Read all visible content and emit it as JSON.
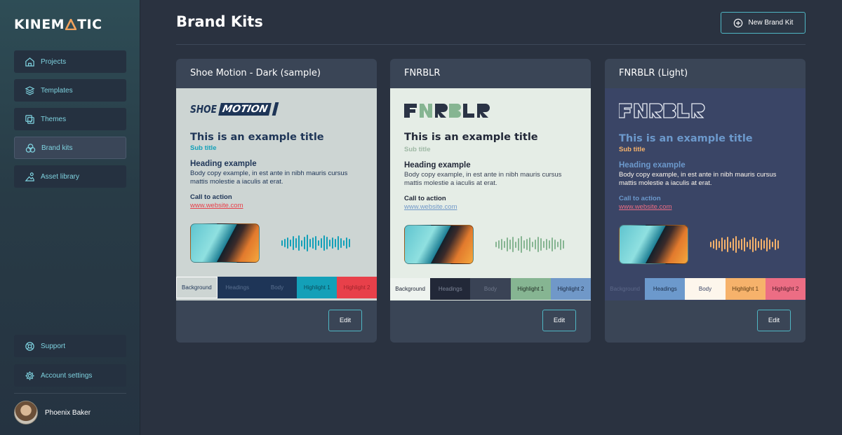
{
  "app": {
    "logo_text_a": "KINEM",
    "logo_text_b": "TIC",
    "accent": "#4fb6c4"
  },
  "sidebar": {
    "items": [
      {
        "label": "Projects",
        "icon": "home-icon"
      },
      {
        "label": "Templates",
        "icon": "layers-icon"
      },
      {
        "label": "Themes",
        "icon": "themes-icon"
      },
      {
        "label": "Brand kits",
        "icon": "palette-icon",
        "active": true
      },
      {
        "label": "Asset library",
        "icon": "image-icon"
      }
    ],
    "bottom_items": [
      {
        "label": "Support",
        "icon": "lifebuoy-icon"
      },
      {
        "label": "Account settings",
        "icon": "gear-icon"
      }
    ],
    "user": {
      "name": "Phoenix Baker"
    }
  },
  "header": {
    "title": "Brand Kits",
    "new_button_label": "New Brand Kit"
  },
  "cards": [
    {
      "title": "Shoe Motion - Dark (sample)",
      "logo_text_a": "SHOE",
      "logo_text_b": "MOTION",
      "preview_title": "This is an example title",
      "preview_subtitle": "Sub title",
      "preview_heading": "Heading example",
      "preview_body": "Body copy example, in est ante in nibh mauris cursus mattis molestie a iaculis at erat.",
      "preview_cta": "Call to action",
      "preview_link": "www.website.com",
      "swatches": [
        "Background",
        "Headings",
        "Body",
        "Highlight 1",
        "Highlight 2"
      ],
      "colors": {
        "background": "#cdd5d3",
        "headings": "#1e3557",
        "body": "#1e3557",
        "highlight1": "#13a0b8",
        "highlight2": "#e8404a"
      },
      "edit_label": "Edit"
    },
    {
      "title": "FNRBLR",
      "logo_text": "FNRBLR",
      "preview_title": "This is an example title",
      "preview_subtitle": "Sub title",
      "preview_heading": "Heading example",
      "preview_body": "Body copy example, in est ante in nibh mauris cursus mattis molestie a iaculis at erat.",
      "preview_cta": "Call to action",
      "preview_link": "www.website.com",
      "swatches": [
        "Background",
        "Headings",
        "Body",
        "Highlight 1",
        "Highlight 2"
      ],
      "colors": {
        "background": "#e5ede6",
        "headings": "#222838",
        "body": "#3a4355",
        "highlight1": "#86b592",
        "highlight2": "#7098c8"
      },
      "edit_label": "Edit"
    },
    {
      "title": "FNRBLR (Light)",
      "logo_text": "FNRBLR",
      "preview_title": "This is an example title",
      "preview_subtitle": "Sub title",
      "preview_heading": "Heading example",
      "preview_body": "Body copy example, in est ante in nibh mauris cursus mattis molestie a iaculis at erat.",
      "preview_cta": "Call to action",
      "preview_link": "www.website.com",
      "swatches": [
        "Background",
        "Headings",
        "Body",
        "Highlight 1",
        "Highlight 2"
      ],
      "colors": {
        "background": "#3a4566",
        "headings": "#6c99cc",
        "body": "#fdf6ec",
        "highlight1": "#f6b26b",
        "highlight2": "#ec6d84"
      },
      "edit_label": "Edit"
    }
  ]
}
